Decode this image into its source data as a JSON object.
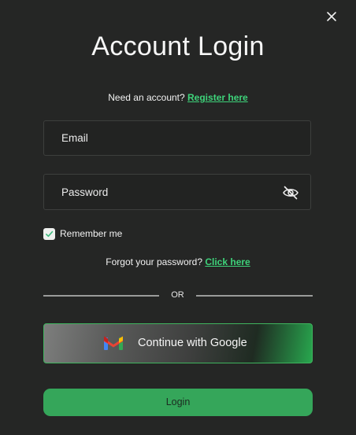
{
  "modal": {
    "title": "Account Login",
    "close_icon": "close-icon"
  },
  "register": {
    "prompt": "Need an account?",
    "link_label": "Register here"
  },
  "email": {
    "placeholder": "Email",
    "value": ""
  },
  "password": {
    "placeholder": "Password",
    "value": "",
    "toggle_icon": "eye-off-icon"
  },
  "remember": {
    "label": "Remember me",
    "checked": true
  },
  "forgot": {
    "prompt": "Forgot your password?",
    "link_label": "Click here"
  },
  "divider": {
    "label": "OR"
  },
  "google": {
    "label": "Continue with Google",
    "icon": "gmail-icon"
  },
  "login": {
    "label": "Login"
  },
  "colors": {
    "background": "#252625",
    "accent": "#3ed37a",
    "login_button": "#35a65a",
    "google_border": "#3fb45e"
  }
}
